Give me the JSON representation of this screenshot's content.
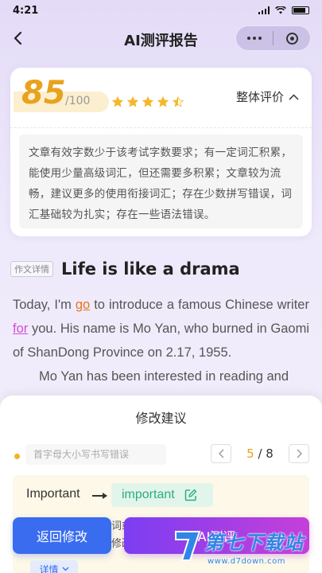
{
  "status_bar": {
    "time": "4:21"
  },
  "nav": {
    "title": "AI测评报告"
  },
  "score": {
    "value": "85",
    "max": "/100",
    "stars_filled": 4.5,
    "stars_total": 5,
    "overall_label": "整体评价",
    "comment": "文章有效字数少于该考试字数要求；有一定词汇积累，能使用少量高级词汇，但还需要多积累；文章较为流畅，建议更多的使用衔接词汇；存在少数拼写错误，词汇基础较为扎实；存在一些语法错误。"
  },
  "essay": {
    "tag": "作文详情",
    "title": "Life is like a drama",
    "p1_before_go": "Today, I'm ",
    "go": "go",
    "p1_mid": " to introduce a famous Chinese writer ",
    "for": "for",
    "p1_after": " you. His name is Mo Yan, who burned in Gaomi of ShanDong Province on 2.17, 1955.",
    "p2": "Mo Yan has been interested in reading and"
  },
  "sheet": {
    "title": "修改建议",
    "tip": "首字母大小写书写错误",
    "page_current": "5",
    "page_total": "/ 8",
    "original_word": "Important",
    "suggested_word": "important",
    "explain_line1": "词或",
    "explain_line2": "修改",
    "details_label": "详情"
  },
  "buttons": {
    "back_label": "返回修改",
    "ai_label": "AI测评"
  },
  "watermark": {
    "main": "第七下载站",
    "sub": "www.d7down.com"
  },
  "colors": {
    "accent_orange": "#e8a21d",
    "primary_blue": "#3a6cf0",
    "gradient_purple": "#7b3ef2",
    "gradient_pink": "#c63fd9",
    "success_green": "#2cae7a"
  }
}
